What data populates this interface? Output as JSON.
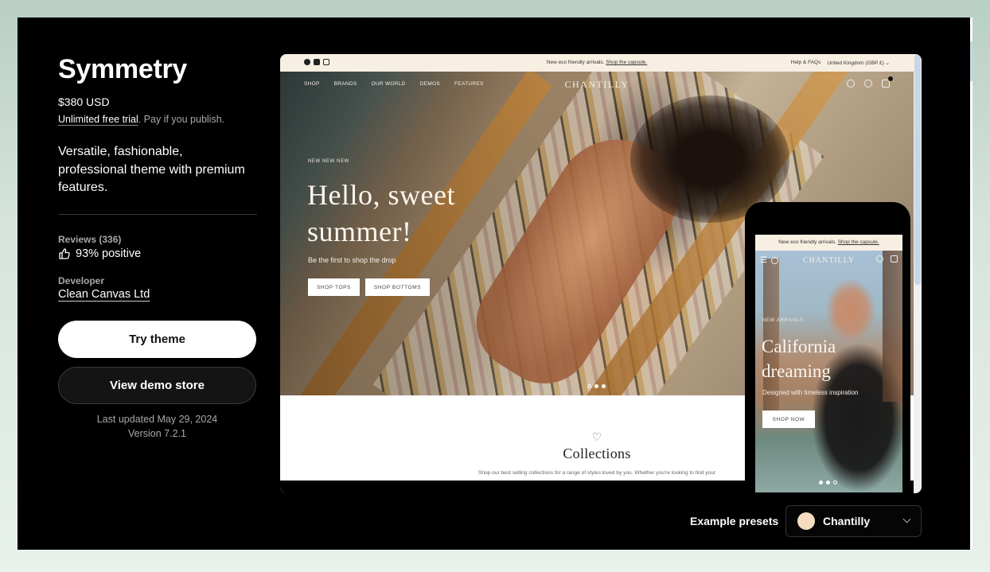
{
  "theme": {
    "name": "Symmetry",
    "price": "$380 USD",
    "trial_link": "Unlimited free trial",
    "trial_suffix": ". Pay if you publish.",
    "description": "Versatile, fashionable, professional theme with premium features.",
    "reviews_label": "Reviews (336)",
    "reviews_value": "93% positive",
    "developer_label": "Developer",
    "developer_name": "Clean Canvas Ltd",
    "try_button": "Try theme",
    "demo_button": "View demo store",
    "last_updated": "Last updated May 29, 2024",
    "version": "Version 7.2.1"
  },
  "desktop_preview": {
    "announcement": "New eco friendly arrivals. ",
    "announcement_link": "Shop the capsule.",
    "help_link": "Help & FAQs",
    "region": "United Kingdom (GBP £) ⌄",
    "nav": [
      "SHOP",
      "BRANDS",
      "OUR WORLD",
      "DEMOS",
      "FEATURES"
    ],
    "logo": "CHANTILLY",
    "cart_count": "0",
    "eyebrow": "NEW NEW NEW",
    "headline": "Hello, sweet summer!",
    "subheading": "Be the first to shop the drop",
    "button_tops": "SHOP TOPS",
    "button_bottoms": "SHOP BOTTOMS",
    "slide_count": 3,
    "active_slide": 1,
    "collections_icon": "♡",
    "collections_title": "Collections",
    "collections_desc": "Shop our best selling collections for a range of styles loved by you. Whether you're looking to find your"
  },
  "mobile_preview": {
    "announcement": "New eco friendly arrivals. ",
    "announcement_link": "Shop the capsule.",
    "logo": "CHANTILLY",
    "eyebrow": "NEW ARRIVALS",
    "headline": "California dreaming",
    "subheading": "Designed with timeless inspiration",
    "button": "SHOP NOW"
  },
  "presets": {
    "label": "Example presets",
    "selected": "Chantilly",
    "swatch_color": "#f3dcc0"
  },
  "colors": {
    "background": "#000000",
    "announcement_bar": "#f8efe3",
    "page_bg": "#b9cfc3"
  }
}
